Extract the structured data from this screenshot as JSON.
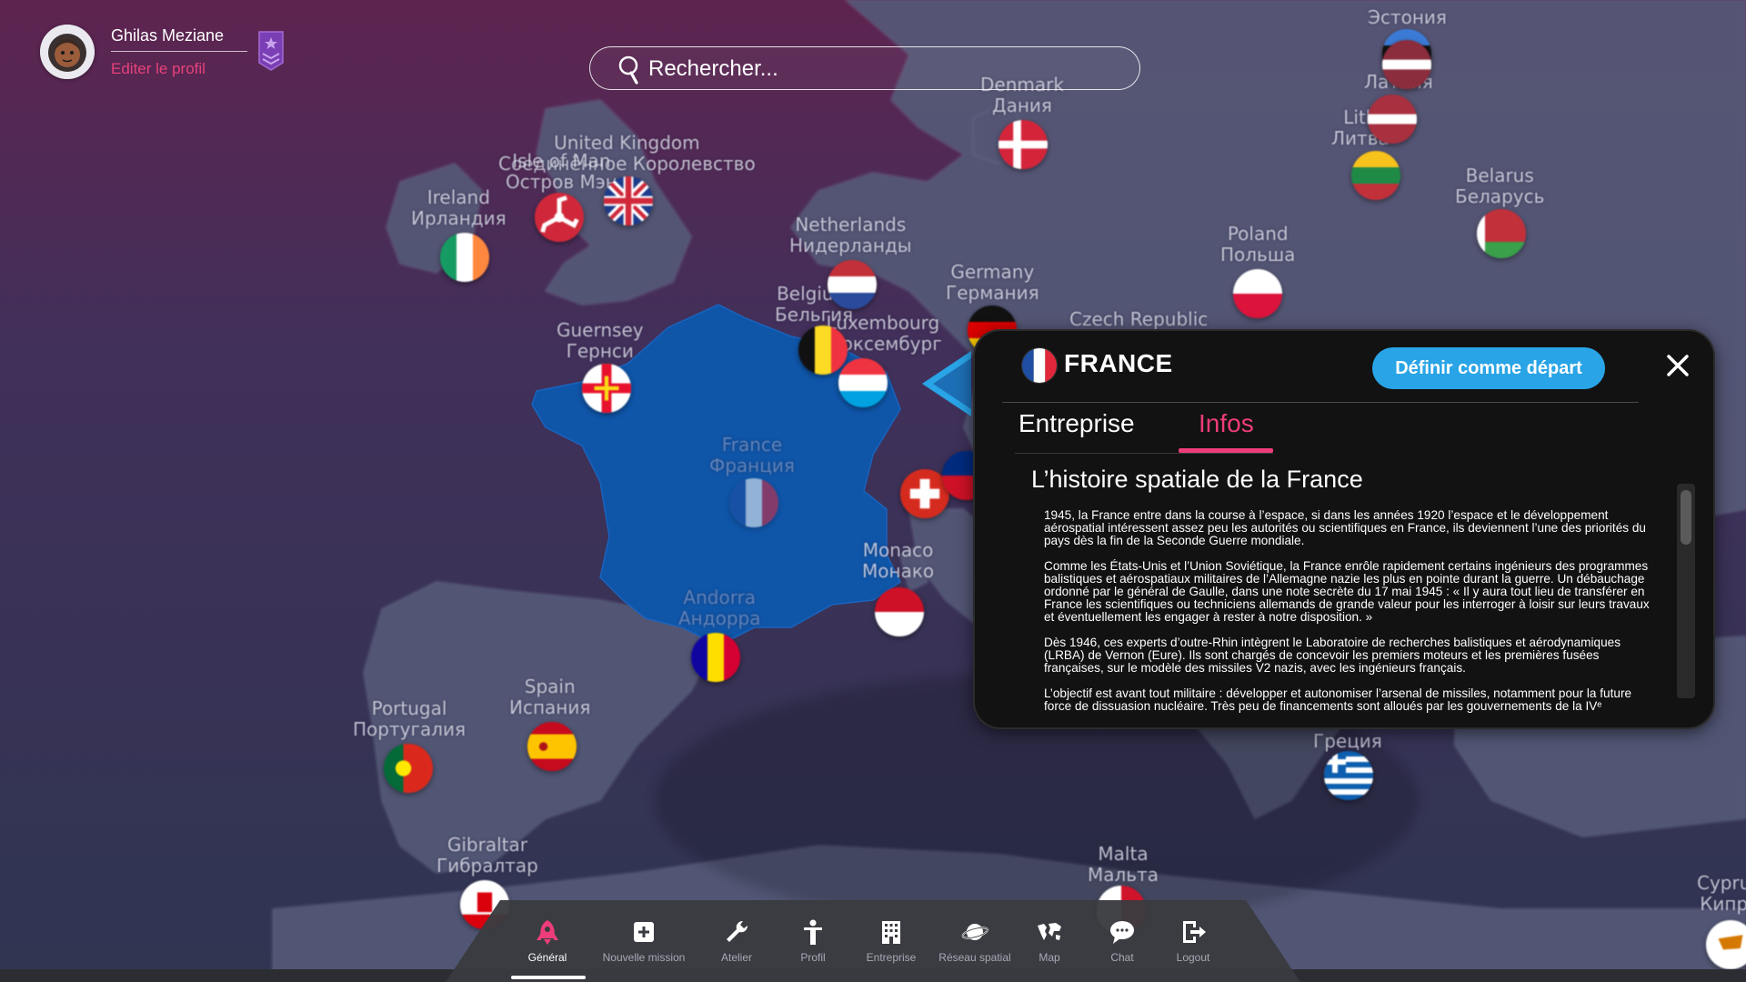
{
  "user": {
    "name": "Ghilas Meziane",
    "edit_profile": "Editer le profil"
  },
  "search": {
    "placeholder": "Rechercher..."
  },
  "map_labels": {
    "estonia": [
      "Эстония"
    ],
    "denmark": [
      "Denmark",
      "Дания"
    ],
    "latvia": [
      "L",
      "Латвия"
    ],
    "lithuania": [
      "Lith",
      "Литва"
    ],
    "united_kingdom": [
      "United Kingdom",
      "Соединённое Королевство"
    ],
    "isle_of_man": [
      "Isle of Man",
      "Остров Мэн"
    ],
    "ireland": [
      "Ireland",
      "Ирландия"
    ],
    "netherlands": [
      "Netherlands",
      "Нидерланды"
    ],
    "belarus": [
      "Belarus",
      "Беларусь"
    ],
    "poland": [
      "Poland",
      "Польша"
    ],
    "germany": [
      "Germany",
      "Германия"
    ],
    "belgium": [
      "Belgium",
      "Бельгия"
    ],
    "luxembourg": [
      "Luxembourg",
      "Люксембург"
    ],
    "czech": [
      "Czech Republic"
    ],
    "guernsey": [
      "Guernsey",
      "Гернси"
    ],
    "france": [
      "France",
      "Франция"
    ],
    "monaco": [
      "Monaco",
      "Монако"
    ],
    "andorra": [
      "Andorra",
      "Андорра"
    ],
    "spain": [
      "Spain",
      "Испания"
    ],
    "portugal": [
      "Portugal",
      "Португалия"
    ],
    "gibraltar": [
      "Gibraltar",
      "Гибралтар"
    ],
    "malta": [
      "Malta",
      "Мальта"
    ],
    "greece": [
      "Греция"
    ],
    "cyprus": [
      "Cypru",
      "Кипр"
    ]
  },
  "panel": {
    "country": "FRANCE",
    "set_start": "Définir comme départ",
    "tabs": {
      "entreprise": "Entreprise",
      "infos": "Infos"
    },
    "active_tab": "Infos",
    "article_title": "L’histoire spatiale de la France",
    "paragraphs": [
      "1945, la France entre dans la course à l’espace, si dans les années 1920 l’espace et le développement aérospatial intéressent assez peu les autorités ou scientifiques en France, ils deviennent l’une des priorités du pays dès la fin de la Seconde Guerre mondiale.",
      "Comme les États-Unis et l’Union Soviétique, la France enrôle rapidement certains ingénieurs des programmes balistiques et aérospatiaux militaires de l’Allemagne nazie les plus en pointe durant la guerre. Un débauchage ordonné par le général de Gaulle, dans une note secrète du 17 mai 1945 : « Il y aura tout lieu de transférer en France les scientifiques ou techniciens allemands de grande valeur pour les interroger à loisir sur leurs travaux et éventuellement les engager à rester à notre disposition. »",
      "Dès 1946, ces experts d’outre-Rhin intègrent le Laboratoire de recherches balistiques et aérodynamiques (LRBA) de Vernon (Eure). Ils sont chargés de concevoir les premiers moteurs et les premières fusées françaises, sur le modèle des missiles V2 nazis, avec les ingénieurs français.",
      "L’objectif est avant tout militaire : développer et autonomiser l’arsenal de missiles, notamment pour la future force de dissuasion nucléaire. Très peu de financements sont alloués par les gouvernements de la IVᵉ"
    ]
  },
  "nav": [
    {
      "label": "Général",
      "icon": "rocket-icon",
      "active": true
    },
    {
      "label": "Nouvelle mission",
      "icon": "plus-square-icon",
      "active": false
    },
    {
      "label": "Atelier",
      "icon": "wrench-icon",
      "active": false
    },
    {
      "label": "Profil",
      "icon": "person-icon",
      "active": false
    },
    {
      "label": "Entreprise",
      "icon": "building-icon",
      "active": false
    },
    {
      "label": "Réseau spatial",
      "icon": "planet-icon",
      "active": false
    },
    {
      "label": "Map",
      "icon": "world-map-icon",
      "active": false
    },
    {
      "label": "Chat",
      "icon": "chat-bubble-icon",
      "active": false
    },
    {
      "label": "Logout",
      "icon": "logout-icon",
      "active": false
    }
  ],
  "colors": {
    "accent_pink": "#ee3d7a",
    "button_blue": "#29a4e6",
    "france_blue": "#0f55a8",
    "panel_bg": "#121212"
  }
}
